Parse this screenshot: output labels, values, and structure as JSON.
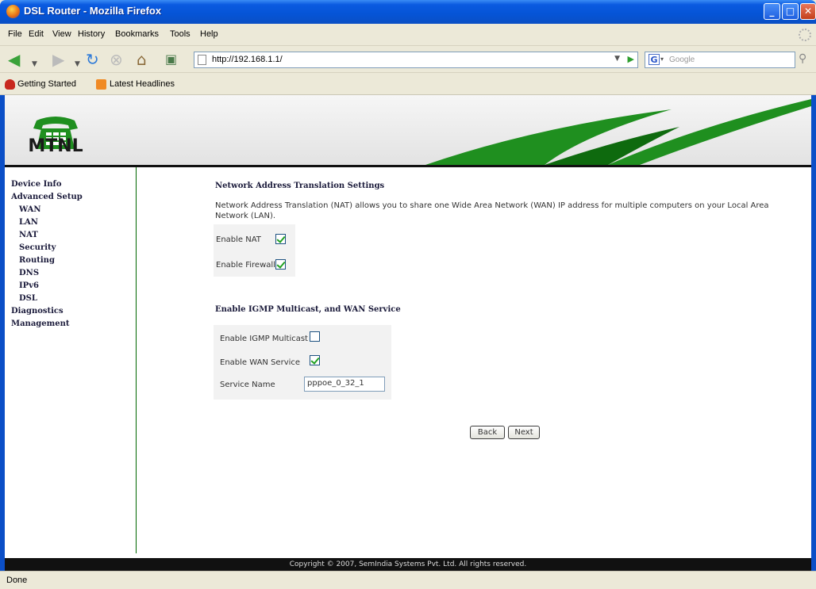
{
  "window": {
    "title": "DSL Router - Mozilla Firefox"
  },
  "menu": [
    "File",
    "Edit",
    "View",
    "History",
    "Bookmarks",
    "Tools",
    "Help"
  ],
  "nav": {
    "url": "http://192.168.1.1/",
    "search_placeholder": "Google"
  },
  "bookmarks": [
    "Getting Started",
    "Latest Headlines"
  ],
  "brand": {
    "logo_text": "MTNL",
    "accent": "#1f8f1f"
  },
  "sidebar": {
    "items": [
      {
        "label": "Device Info"
      },
      {
        "label": "Advanced Setup"
      },
      {
        "label": "WAN"
      },
      {
        "label": "LAN"
      },
      {
        "label": "NAT"
      },
      {
        "label": "Security"
      },
      {
        "label": "Routing"
      },
      {
        "label": "DNS"
      },
      {
        "label": "IPv6"
      },
      {
        "label": "DSL"
      },
      {
        "label": "Diagnostics"
      },
      {
        "label": "Management"
      }
    ]
  },
  "nat": {
    "title": "Network Address Translation Settings",
    "description": "Network Address Translation (NAT) allows you to share one Wide Area Network (WAN) IP address for multiple computers on your Local Area Network (LAN).",
    "enable_nat_label": "Enable NAT",
    "enable_nat": true,
    "enable_firewall_label": "Enable Firewall",
    "enable_firewall": true
  },
  "igmp": {
    "title": "Enable IGMP Multicast, and WAN Service",
    "enable_igmp_label": "Enable IGMP Multicast",
    "enable_igmp": false,
    "enable_wan_label": "Enable WAN Service",
    "enable_wan": true,
    "service_name_label": "Service Name",
    "service_name": "pppoe_0_32_1"
  },
  "buttons": {
    "back": "Back",
    "next": "Next"
  },
  "footer": "Copyright © 2007, SemIndia Systems Pvt. Ltd. All rights reserved.",
  "status": "Done"
}
